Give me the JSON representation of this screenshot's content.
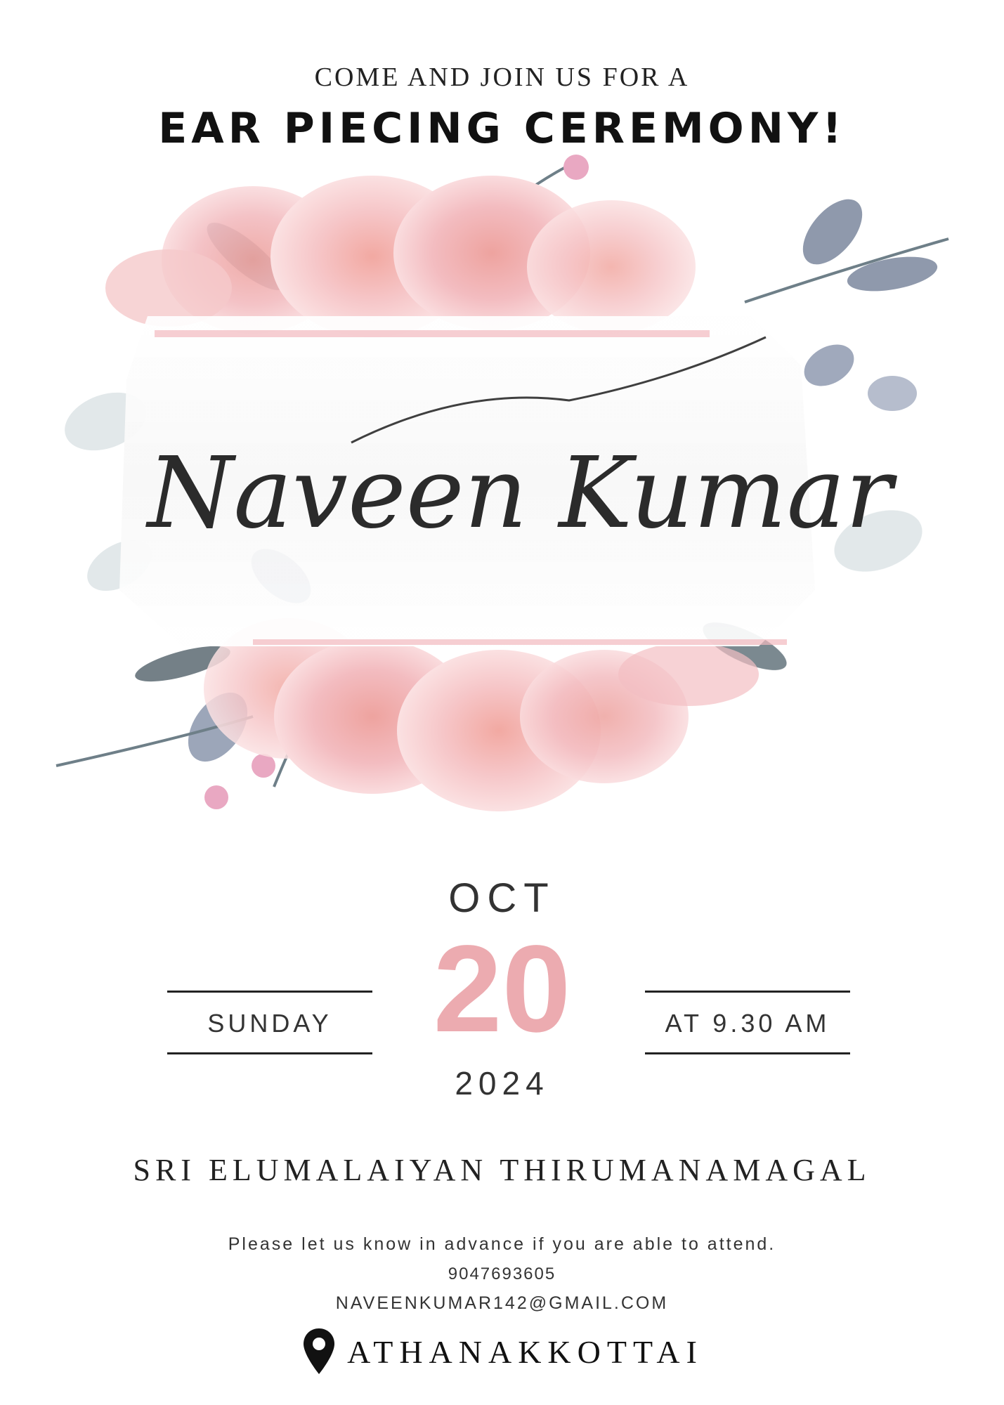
{
  "invite": {
    "intro": "COME AND JOIN US FOR  A",
    "title": "EAR PIECING CEREMONY!",
    "name": "Naveen Kumar",
    "date": {
      "month": "OCT",
      "day": "20",
      "year": "2024",
      "weekday": "SUNDAY",
      "time": "AT 9.30 AM"
    },
    "venue": "SRI ELUMALAIYAN THIRUMANAMAGAL",
    "rsvp_note": "Please let us know in advance if you are able to attend.",
    "phone": "9047693605",
    "email": "NAVEENKUMAR142@GMAIL.COM",
    "location": "ATHANAKKOTTAI",
    "location_icon": "map-pin-icon"
  },
  "colors": {
    "accent_pink": "#ecabb0",
    "rose": "#f4c3c7",
    "leaf": "#6f7d93",
    "text": "#222222"
  }
}
